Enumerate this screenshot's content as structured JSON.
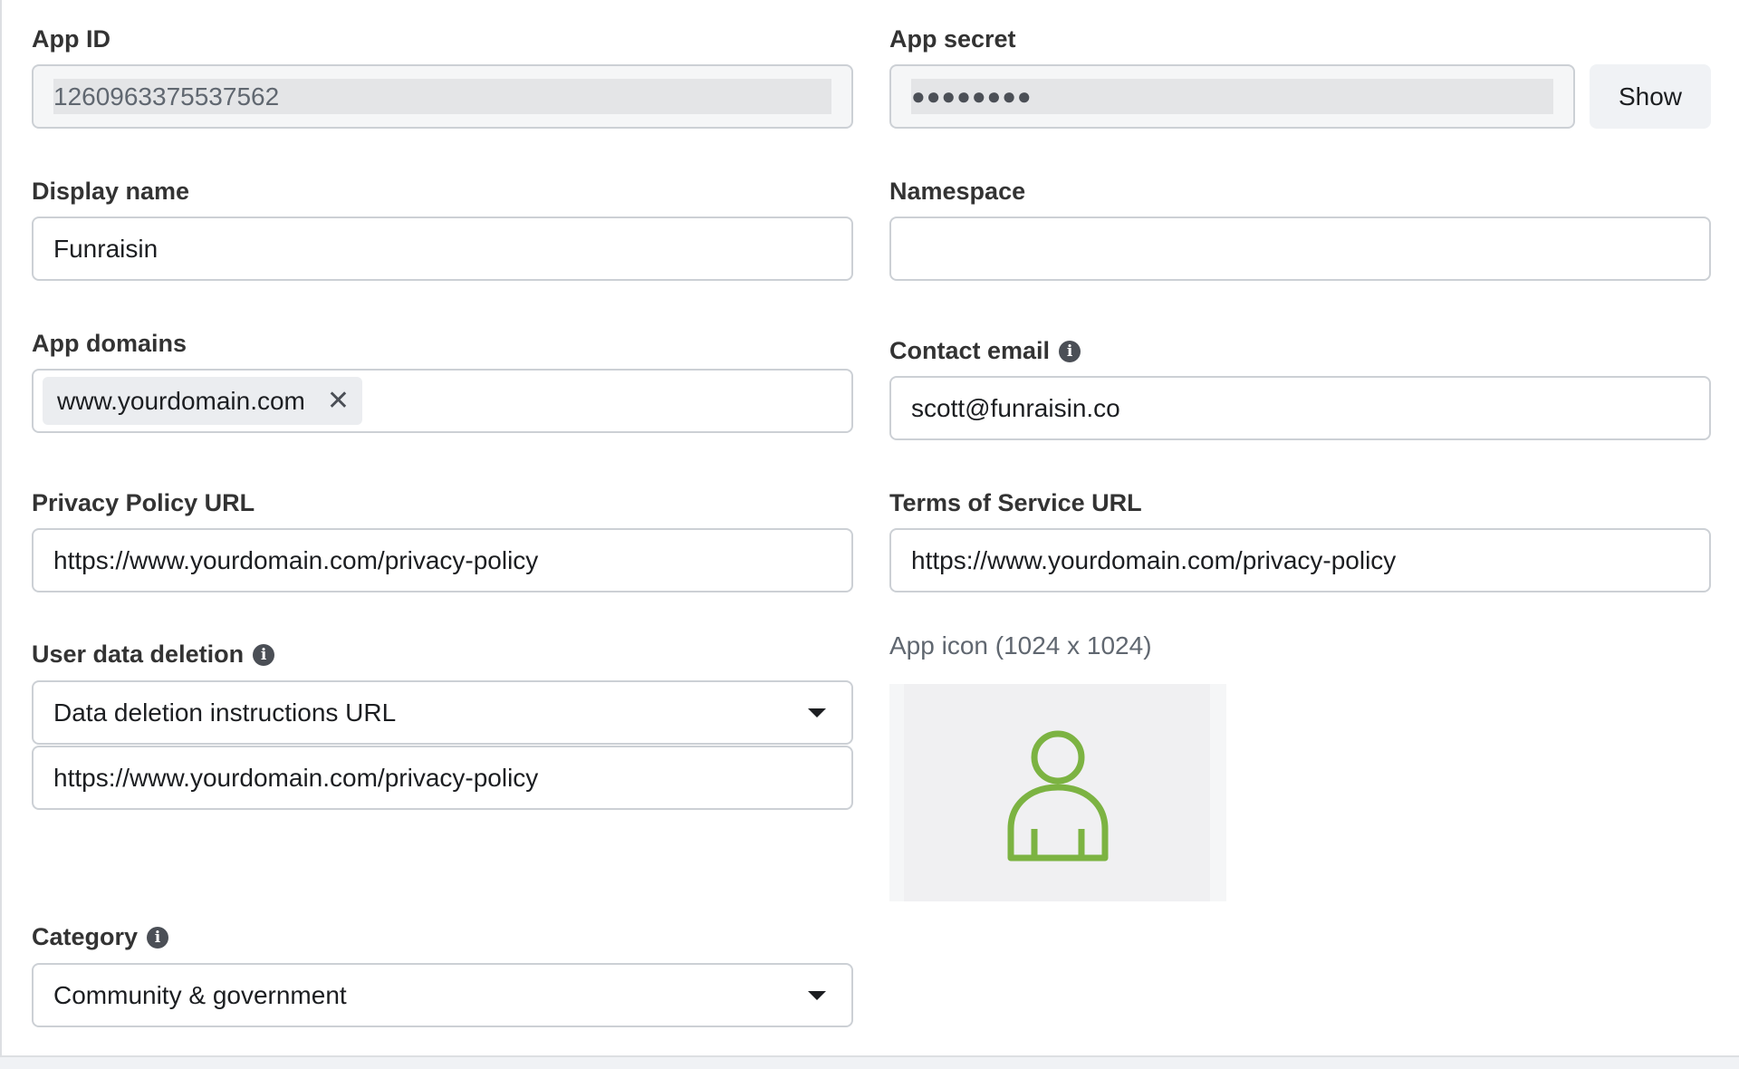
{
  "app_id": {
    "label": "App ID",
    "value": "1260963375537562"
  },
  "app_secret": {
    "label": "App secret",
    "value": "●●●●●●●●",
    "show_label": "Show"
  },
  "display_name": {
    "label": "Display name",
    "value": "Funraisin"
  },
  "namespace": {
    "label": "Namespace",
    "value": ""
  },
  "app_domains": {
    "label": "App domains",
    "tags": [
      "www.yourdomain.com"
    ],
    "remove_glyph": "✕"
  },
  "contact_email": {
    "label": "Contact email",
    "value": "scott@funraisin.co"
  },
  "privacy_policy": {
    "label": "Privacy Policy URL",
    "value": "https://www.yourdomain.com/privacy-policy"
  },
  "terms_of_service": {
    "label": "Terms of Service URL",
    "value": "https://www.yourdomain.com/privacy-policy"
  },
  "user_data_deletion": {
    "label": "User data deletion",
    "selected": "Data deletion instructions URL",
    "url_value": "https://www.yourdomain.com/privacy-policy"
  },
  "app_icon": {
    "label": "App icon (1024 x 1024)",
    "placeholder_icon": "user-icon",
    "icon_color": "#7cb342"
  },
  "category": {
    "label": "Category",
    "selected": "Community & government"
  },
  "info_glyph": "i",
  "colors": {
    "border": "#ccd0d5",
    "label": "#333333",
    "muted": "#606770",
    "accent_green": "#7cb342"
  }
}
